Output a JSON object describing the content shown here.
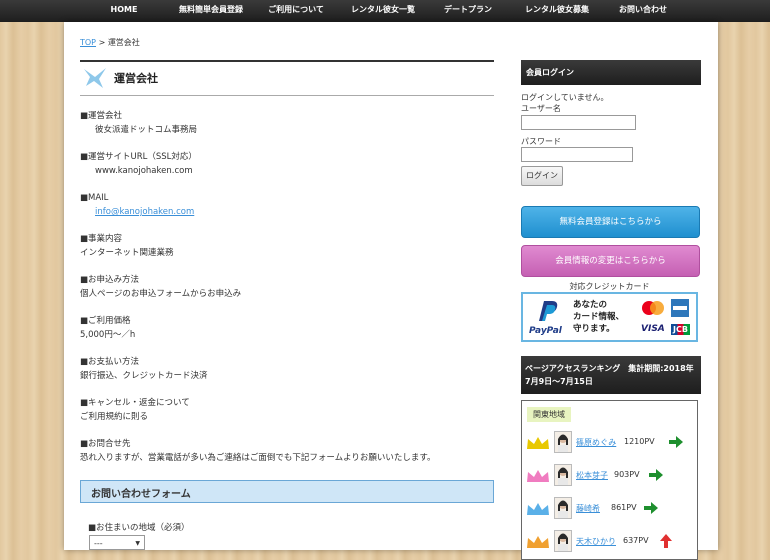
{
  "nav": {
    "items": [
      "HOME",
      "無料簡単会員登録",
      "ご利用について",
      "レンタル彼女一覧",
      "デートプラン",
      "レンタル彼女募集",
      "お問い合わせ"
    ]
  },
  "breadcrumb": {
    "top": "TOP",
    "separator": ">",
    "current": "運営会社"
  },
  "heading": {
    "title": "運営会社"
  },
  "sections": [
    {
      "label": "■運営会社",
      "value": "彼女派遣ドットコム事務局",
      "indent": true
    },
    {
      "label": "■運営サイトURL（SSL対応）",
      "value": "www.kanojohaken.com",
      "indent": true
    },
    {
      "label": "■MAIL",
      "value": "info@kanojohaken.com",
      "indent": true,
      "link": true
    },
    {
      "label": "■事業内容",
      "value": "インターネット関連業務",
      "indent": false
    },
    {
      "label": "■お申込み方法",
      "value": "個人ページのお申込フォームからお申込み",
      "indent": false
    },
    {
      "label": "■ご利用価格",
      "value": "5,000円～／h",
      "indent": false
    },
    {
      "label": "■お支払い方法",
      "value": "銀行振込、クレジットカード決済",
      "indent": false
    },
    {
      "label": "■キャンセル・返金について",
      "value": "ご利用規約に則る",
      "indent": false
    },
    {
      "label": "■お問合せ先",
      "value": "恐れ入りますが、営業電話が多い為ご連絡はご面倒でも下記フォームよりお願いいたします。",
      "indent": false
    }
  ],
  "form": {
    "title": "お問い合わせフォーム",
    "address_label": "■お住まいの地域（必須）",
    "address_value": "---"
  },
  "sidebar": {
    "login_title": "会員ログイン",
    "login_status": "ログインしていません。",
    "username_label": "ユーザー名",
    "password_label": "パスワード",
    "login_button": "ログイン",
    "register_button": "無料会員登録はこちらから",
    "update_button": "会員情報の変更はこちらから",
    "cc_label": "対応クレジットカード",
    "cc_banner": {
      "paypal": "PayPal",
      "text_lines": [
        "あなたの",
        "カード情報、",
        "守ります。"
      ],
      "cards": [
        "VISA",
        "JCB"
      ]
    },
    "ranking_title": "ページアクセスランキング　集計期間:2018年7月9日～7月15日",
    "ranking_region": "関東地域",
    "ranking": [
      {
        "name": "篠原めぐみ",
        "pv": "1210PV",
        "trend": "right",
        "crown": "#e8c800"
      },
      {
        "name": "松本芽子",
        "pv": "903PV",
        "trend": "right",
        "crown": "#f07cc0"
      },
      {
        "name": "藤崎希",
        "pv": "861PV",
        "trend": "right",
        "crown": "#5ab0e8"
      },
      {
        "name": "天木ひかり",
        "pv": "637PV",
        "trend": "up",
        "crown": "#f0a030"
      }
    ]
  },
  "colors": {
    "link": "#3a8fd8",
    "arrow_green": "#1e8f2e",
    "arrow_red": "#e03030",
    "register_blue": "#1f8fcf",
    "update_pink": "#c560b3"
  }
}
